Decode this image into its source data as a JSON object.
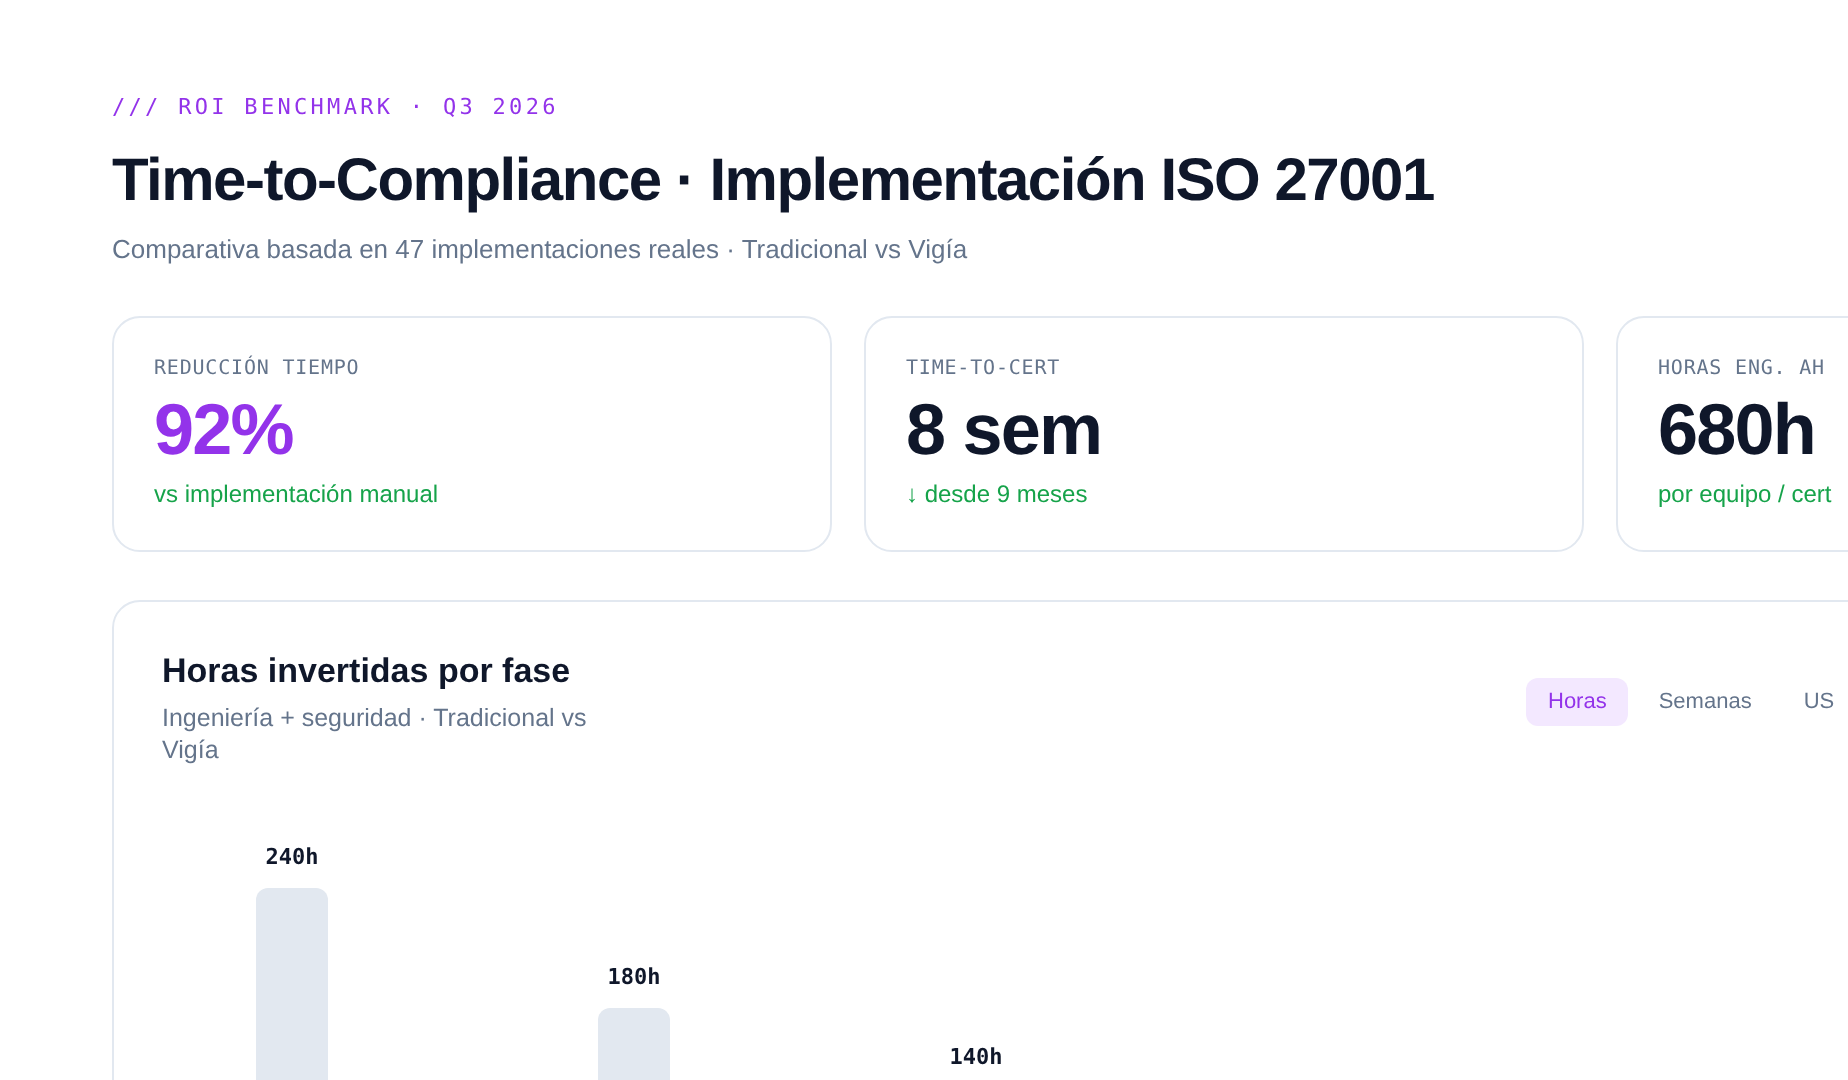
{
  "eyebrow": "/// ROI BENCHMARK · Q3 2026",
  "title": "Time-to-Compliance · Implementación ISO 27001",
  "subtitle": "Comparativa basada en 47 implementaciones reales · Tradicional vs Vigía",
  "stats": [
    {
      "label": "REDUCCIÓN TIEMPO",
      "value": "92%",
      "note": "vs implementación manual",
      "highlight": true
    },
    {
      "label": "TIME-TO-CERT",
      "value": "8 sem",
      "note": "↓ desde 9 meses",
      "highlight": false
    },
    {
      "label": "HORAS ENG. AH",
      "value": "680h",
      "note": "por equipo / cert",
      "highlight": false
    }
  ],
  "chart_card": {
    "title": "Horas invertidas por fase",
    "subtitle": "Ingeniería + seguridad · Tradicional vs Vigía",
    "tabs": [
      {
        "label": "Horas",
        "selected": true
      },
      {
        "label": "Semanas",
        "selected": false
      },
      {
        "label": "US",
        "selected": false
      }
    ],
    "bars": [
      {
        "value_label": "240h"
      },
      {
        "value_label": "180h"
      },
      {
        "value_label": "140h"
      }
    ]
  }
}
